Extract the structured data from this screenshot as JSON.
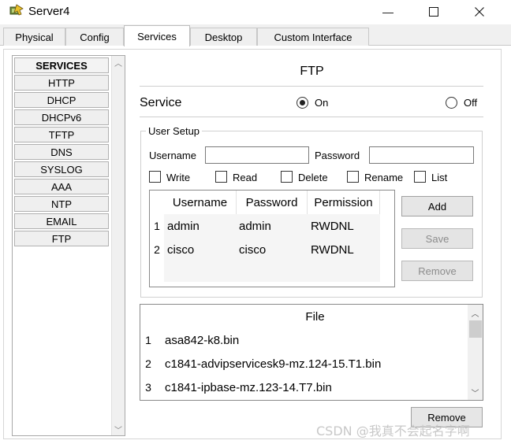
{
  "window": {
    "title": "Server4",
    "minimize_glyph": "—",
    "maximize_glyph": "☐",
    "close_glyph": "✕"
  },
  "tabs": [
    {
      "label": "Physical"
    },
    {
      "label": "Config"
    },
    {
      "label": "Services",
      "active": true
    },
    {
      "label": "Desktop"
    },
    {
      "label": "Custom Interface"
    }
  ],
  "services": {
    "header": "SERVICES",
    "items": [
      "HTTP",
      "DHCP",
      "DHCPv6",
      "TFTP",
      "DNS",
      "SYSLOG",
      "AAA",
      "NTP",
      "EMAIL",
      "FTP"
    ]
  },
  "ftp": {
    "title": "FTP",
    "service_label": "Service",
    "on_label": "On",
    "off_label": "Off",
    "service_on": true
  },
  "user_setup": {
    "legend": "User Setup",
    "username_label": "Username",
    "username_value": "",
    "password_label": "Password",
    "password_value": "",
    "permissions": [
      {
        "label": "Write",
        "checked": false
      },
      {
        "label": "Read",
        "checked": false
      },
      {
        "label": "Delete",
        "checked": false
      },
      {
        "label": "Rename",
        "checked": false
      },
      {
        "label": "List",
        "checked": false
      }
    ],
    "table": {
      "columns": [
        "Username",
        "Password",
        "Permission"
      ],
      "rows": [
        {
          "num": "1",
          "username": "admin",
          "password": "admin",
          "permission": "RWDNL"
        },
        {
          "num": "2",
          "username": "cisco",
          "password": "cisco",
          "permission": "RWDNL"
        }
      ]
    },
    "add_label": "Add",
    "save_label": "Save",
    "remove_label": "Remove"
  },
  "files": {
    "header": "File",
    "rows": [
      {
        "num": "1",
        "name": "asa842-k8.bin"
      },
      {
        "num": "2",
        "name": "c1841-advipservicesk9-mz.124-15.T1.bin"
      },
      {
        "num": "3",
        "name": "c1841-ipbase-mz.123-14.T7.bin"
      }
    ],
    "remove_label": "Remove"
  },
  "watermark": "CSDN @我真不会起名字啊",
  "colors": {
    "tab_bg": "#efefef",
    "active_tab_bg": "#ffffff",
    "button_bg": "#e6e6e6",
    "disabled_text": "#8c8c8c",
    "row_highlight": "#f5f5f5"
  }
}
